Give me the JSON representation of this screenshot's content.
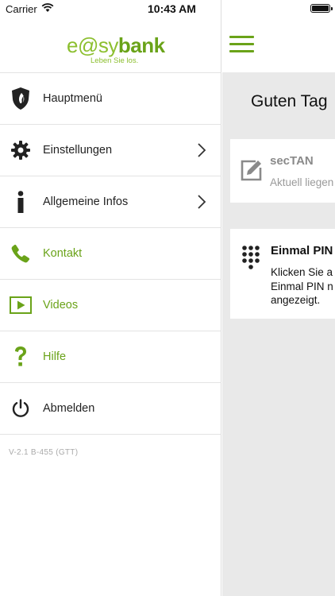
{
  "status_bar": {
    "carrier": "Carrier",
    "time": "10:43 AM"
  },
  "logo": {
    "brand_part1": "e@sy",
    "brand_part2": "bank",
    "tagline": "Leben Sie los."
  },
  "menu": {
    "items": [
      {
        "label": "Hauptmenü",
        "icon": "shield-icon"
      },
      {
        "label": "Einstellungen",
        "icon": "gear-icon"
      },
      {
        "label": "Allgemeine Infos",
        "icon": "info-icon"
      },
      {
        "label": "Kontakt",
        "icon": "phone-icon"
      },
      {
        "label": "Videos",
        "icon": "play-icon"
      },
      {
        "label": "Hilfe",
        "icon": "question-icon"
      },
      {
        "label": "Abmelden",
        "icon": "power-icon"
      }
    ],
    "version": "V-2.1 B-455 (GTT)"
  },
  "main": {
    "greeting": "Guten Tag",
    "sectan_card": {
      "title": "secTAN",
      "subtitle": "Aktuell liegen"
    },
    "pin_card": {
      "title": "Einmal PIN",
      "line1": "Klicken Sie a",
      "line2": "Einmal PIN n",
      "line3": "angezeigt."
    }
  },
  "colors": {
    "accent_green": "#6aa319",
    "logo_green": "#8cbf2f",
    "content_bg": "#e9e9e9"
  }
}
